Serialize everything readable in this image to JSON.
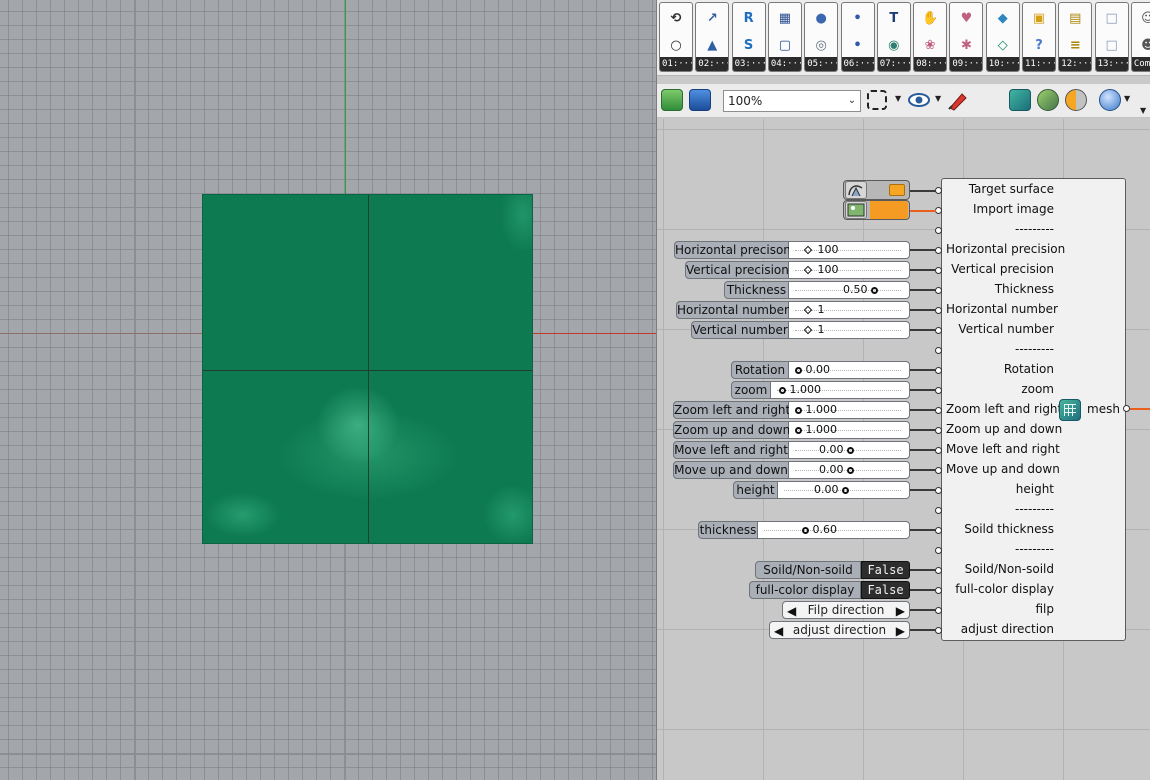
{
  "viewport": {
    "mesh_color": "#0e7a52",
    "x_axis_color": "#c0392b",
    "y_axis_color": "#2ea043"
  },
  "ribbon": {
    "tabs": [
      {
        "label": "01:···",
        "icons": [
          "curve-params-icon",
          "circle-icon"
        ]
      },
      {
        "label": "02:···",
        "icons": [
          "transform-icon",
          "network-icon"
        ]
      },
      {
        "label": "03:···",
        "icons": [
          "re-surface-icon",
          "sq-surface-icon"
        ]
      },
      {
        "label": "04:···",
        "icons": [
          "grid-surface-icon",
          "square-frame-icon"
        ]
      },
      {
        "label": "05:···",
        "icons": [
          "spheres-icon",
          "sphere-outline-icon"
        ]
      },
      {
        "label": "06:···",
        "icons": [
          "connect-nodes-icon",
          "link-nodes-icon"
        ]
      },
      {
        "label": "07:···",
        "icons": [
          "text-icon",
          "globe-icon"
        ]
      },
      {
        "label": "08:···",
        "icons": [
          "hand-icon",
          "atom-icon"
        ]
      },
      {
        "label": "09:···",
        "icons": [
          "brain-icon",
          "figures-icon"
        ]
      },
      {
        "label": "10:···",
        "icons": [
          "mesh-tile-icon",
          "mesh-wave-icon"
        ]
      },
      {
        "label": "11:···",
        "icons": [
          "colors-icon",
          "question-icon"
        ]
      },
      {
        "label": "12:···",
        "icons": [
          "box-icon",
          "stack-icon"
        ]
      },
      {
        "label": "13:···",
        "icons": [
          "shape-icon",
          "shield-shape-icon"
        ]
      },
      {
        "label": "Com··",
        "icons": [
          "person-icon",
          "people-icon"
        ]
      }
    ]
  },
  "toolbar": {
    "zoom_value": "100%"
  },
  "component": {
    "inputs": [
      "Target surface",
      "Import image",
      "---------",
      "Horizontal precision",
      "Vertical precision",
      "Thickness",
      "Horizontal number",
      "Vertical number",
      "---------",
      "Rotation",
      "zoom",
      "Zoom left and right",
      "Zoom up and down",
      "Move left and right",
      "Move up and down",
      "height",
      "---------",
      "Soild thickness",
      "---------",
      "Soild/Non-soild",
      "full-color display",
      "filp",
      "adjust direction"
    ],
    "output": "mesh"
  },
  "sliders": [
    {
      "name": "Horizontal precison",
      "value": "100",
      "knob": "diamond"
    },
    {
      "name": "Vertical precision",
      "value": "100",
      "knob": "diamond"
    },
    {
      "name": "Thickness",
      "value": "0.50",
      "knob": "ring-right"
    },
    {
      "name": "Horizontal number",
      "value": "1",
      "knob": "diamond"
    },
    {
      "name": "Vertical number",
      "value": "1",
      "knob": "diamond"
    },
    {
      "name": "Rotation",
      "value": "0.00",
      "knob": "ring-left"
    },
    {
      "name": "zoom",
      "value": "1.000",
      "knob": "ring-left"
    },
    {
      "name": "Zoom left and right",
      "value": "1.000",
      "knob": "ring-left"
    },
    {
      "name": "Zoom up and down",
      "value": "1.000",
      "knob": "ring-left"
    },
    {
      "name": "Move left and right",
      "value": "0.00",
      "knob": "ring-right"
    },
    {
      "name": "Move up and down",
      "value": "0.00",
      "knob": "ring-right"
    },
    {
      "name": "height",
      "value": "0.00",
      "knob": "ring-right"
    },
    {
      "name": "thickness",
      "value": "0.60",
      "knob": "ring-left"
    }
  ],
  "toggles": [
    {
      "name": "Soild/Non-soild",
      "value": "False"
    },
    {
      "name": "full-color display",
      "value": "False"
    }
  ],
  "value_lists": [
    {
      "name": "Filp direction"
    },
    {
      "name": "adjust direction"
    }
  ],
  "params": [
    {
      "tag_color": "#b7b7b7",
      "accent": "#f5a623"
    },
    {
      "tag_color": "#f59a23"
    }
  ]
}
